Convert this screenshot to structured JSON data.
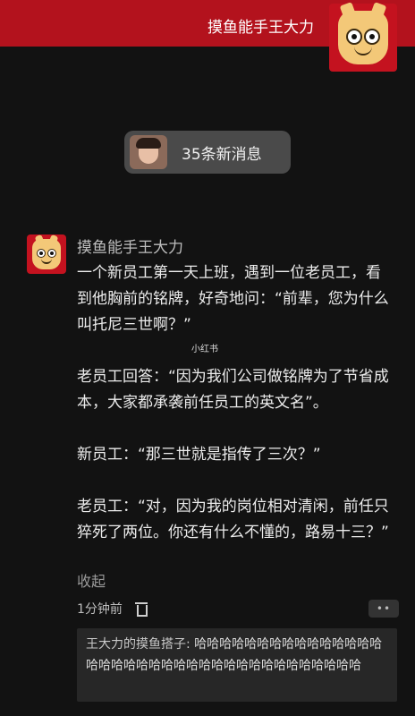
{
  "header": {
    "title": "摸鱼能手王大力"
  },
  "new_messages": {
    "label": "35条新消息"
  },
  "post": {
    "author": "摸鱼能手王大力",
    "paragraphs": [
      "一个新员工第一天上班，遇到一位老员工，看到他胸前的铭牌，好奇地问：“前辈，您为什么叫托尼三世啊？”",
      "老员工回答：“因为我们公司做铭牌为了节省成本，大家都承袭前任员工的英文名”。",
      "新员工：“那三世就是指传了三次？”",
      "老员工：“对，因为我的岗位相对清闲，前任只猝死了两位。你还有什么不懂的，路易十三？”"
    ],
    "collapse_label": "收起",
    "time": "1分钟前",
    "more_label": "••"
  },
  "watermark": "小红书",
  "reply": {
    "user": "王大力的摸鱼搭子:",
    "text": " 哈哈哈哈哈哈哈哈哈哈哈哈哈哈哈哈哈哈哈哈哈哈哈哈哈哈哈哈哈哈哈哈哈哈哈哈哈"
  }
}
